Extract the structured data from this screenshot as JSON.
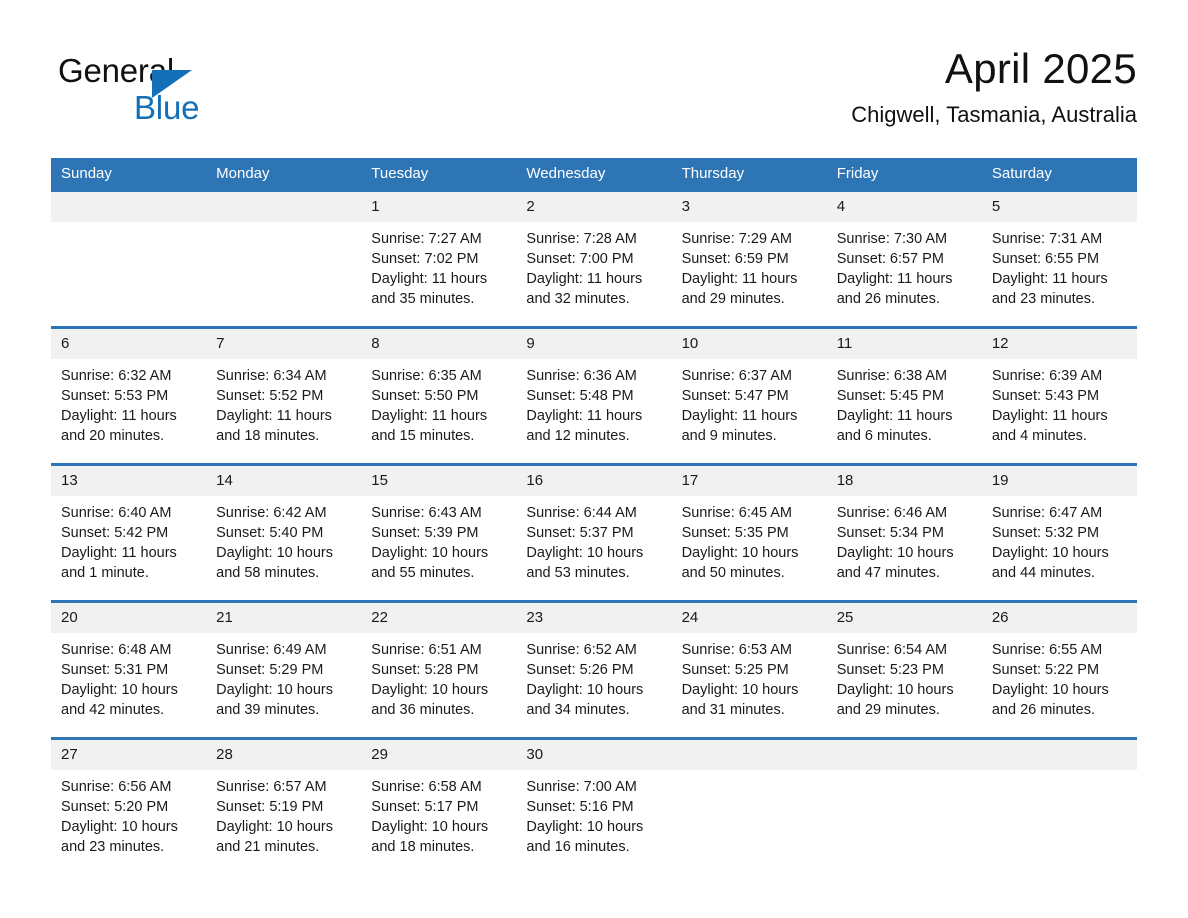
{
  "brand": {
    "name_part1": "General",
    "name_part2": "Blue",
    "accent_color": "#1470b6"
  },
  "header": {
    "month_title": "April 2025",
    "location": "Chigwell, Tasmania, Australia"
  },
  "calendar": {
    "header_background": "#2e75b6",
    "daynum_background": "#f1f1f1",
    "weekday_headers": [
      "Sunday",
      "Monday",
      "Tuesday",
      "Wednesday",
      "Thursday",
      "Friday",
      "Saturday"
    ],
    "weeks": [
      [
        {
          "day": "",
          "sunrise": "",
          "sunset": "",
          "daylight": ""
        },
        {
          "day": "",
          "sunrise": "",
          "sunset": "",
          "daylight": ""
        },
        {
          "day": "1",
          "sunrise": "Sunrise: 7:27 AM",
          "sunset": "Sunset: 7:02 PM",
          "daylight": "Daylight: 11 hours and 35 minutes."
        },
        {
          "day": "2",
          "sunrise": "Sunrise: 7:28 AM",
          "sunset": "Sunset: 7:00 PM",
          "daylight": "Daylight: 11 hours and 32 minutes."
        },
        {
          "day": "3",
          "sunrise": "Sunrise: 7:29 AM",
          "sunset": "Sunset: 6:59 PM",
          "daylight": "Daylight: 11 hours and 29 minutes."
        },
        {
          "day": "4",
          "sunrise": "Sunrise: 7:30 AM",
          "sunset": "Sunset: 6:57 PM",
          "daylight": "Daylight: 11 hours and 26 minutes."
        },
        {
          "day": "5",
          "sunrise": "Sunrise: 7:31 AM",
          "sunset": "Sunset: 6:55 PM",
          "daylight": "Daylight: 11 hours and 23 minutes."
        }
      ],
      [
        {
          "day": "6",
          "sunrise": "Sunrise: 6:32 AM",
          "sunset": "Sunset: 5:53 PM",
          "daylight": "Daylight: 11 hours and 20 minutes."
        },
        {
          "day": "7",
          "sunrise": "Sunrise: 6:34 AM",
          "sunset": "Sunset: 5:52 PM",
          "daylight": "Daylight: 11 hours and 18 minutes."
        },
        {
          "day": "8",
          "sunrise": "Sunrise: 6:35 AM",
          "sunset": "Sunset: 5:50 PM",
          "daylight": "Daylight: 11 hours and 15 minutes."
        },
        {
          "day": "9",
          "sunrise": "Sunrise: 6:36 AM",
          "sunset": "Sunset: 5:48 PM",
          "daylight": "Daylight: 11 hours and 12 minutes."
        },
        {
          "day": "10",
          "sunrise": "Sunrise: 6:37 AM",
          "sunset": "Sunset: 5:47 PM",
          "daylight": "Daylight: 11 hours and 9 minutes."
        },
        {
          "day": "11",
          "sunrise": "Sunrise: 6:38 AM",
          "sunset": "Sunset: 5:45 PM",
          "daylight": "Daylight: 11 hours and 6 minutes."
        },
        {
          "day": "12",
          "sunrise": "Sunrise: 6:39 AM",
          "sunset": "Sunset: 5:43 PM",
          "daylight": "Daylight: 11 hours and 4 minutes."
        }
      ],
      [
        {
          "day": "13",
          "sunrise": "Sunrise: 6:40 AM",
          "sunset": "Sunset: 5:42 PM",
          "daylight": "Daylight: 11 hours and 1 minute."
        },
        {
          "day": "14",
          "sunrise": "Sunrise: 6:42 AM",
          "sunset": "Sunset: 5:40 PM",
          "daylight": "Daylight: 10 hours and 58 minutes."
        },
        {
          "day": "15",
          "sunrise": "Sunrise: 6:43 AM",
          "sunset": "Sunset: 5:39 PM",
          "daylight": "Daylight: 10 hours and 55 minutes."
        },
        {
          "day": "16",
          "sunrise": "Sunrise: 6:44 AM",
          "sunset": "Sunset: 5:37 PM",
          "daylight": "Daylight: 10 hours and 53 minutes."
        },
        {
          "day": "17",
          "sunrise": "Sunrise: 6:45 AM",
          "sunset": "Sunset: 5:35 PM",
          "daylight": "Daylight: 10 hours and 50 minutes."
        },
        {
          "day": "18",
          "sunrise": "Sunrise: 6:46 AM",
          "sunset": "Sunset: 5:34 PM",
          "daylight": "Daylight: 10 hours and 47 minutes."
        },
        {
          "day": "19",
          "sunrise": "Sunrise: 6:47 AM",
          "sunset": "Sunset: 5:32 PM",
          "daylight": "Daylight: 10 hours and 44 minutes."
        }
      ],
      [
        {
          "day": "20",
          "sunrise": "Sunrise: 6:48 AM",
          "sunset": "Sunset: 5:31 PM",
          "daylight": "Daylight: 10 hours and 42 minutes."
        },
        {
          "day": "21",
          "sunrise": "Sunrise: 6:49 AM",
          "sunset": "Sunset: 5:29 PM",
          "daylight": "Daylight: 10 hours and 39 minutes."
        },
        {
          "day": "22",
          "sunrise": "Sunrise: 6:51 AM",
          "sunset": "Sunset: 5:28 PM",
          "daylight": "Daylight: 10 hours and 36 minutes."
        },
        {
          "day": "23",
          "sunrise": "Sunrise: 6:52 AM",
          "sunset": "Sunset: 5:26 PM",
          "daylight": "Daylight: 10 hours and 34 minutes."
        },
        {
          "day": "24",
          "sunrise": "Sunrise: 6:53 AM",
          "sunset": "Sunset: 5:25 PM",
          "daylight": "Daylight: 10 hours and 31 minutes."
        },
        {
          "day": "25",
          "sunrise": "Sunrise: 6:54 AM",
          "sunset": "Sunset: 5:23 PM",
          "daylight": "Daylight: 10 hours and 29 minutes."
        },
        {
          "day": "26",
          "sunrise": "Sunrise: 6:55 AM",
          "sunset": "Sunset: 5:22 PM",
          "daylight": "Daylight: 10 hours and 26 minutes."
        }
      ],
      [
        {
          "day": "27",
          "sunrise": "Sunrise: 6:56 AM",
          "sunset": "Sunset: 5:20 PM",
          "daylight": "Daylight: 10 hours and 23 minutes."
        },
        {
          "day": "28",
          "sunrise": "Sunrise: 6:57 AM",
          "sunset": "Sunset: 5:19 PM",
          "daylight": "Daylight: 10 hours and 21 minutes."
        },
        {
          "day": "29",
          "sunrise": "Sunrise: 6:58 AM",
          "sunset": "Sunset: 5:17 PM",
          "daylight": "Daylight: 10 hours and 18 minutes."
        },
        {
          "day": "30",
          "sunrise": "Sunrise: 7:00 AM",
          "sunset": "Sunset: 5:16 PM",
          "daylight": "Daylight: 10 hours and 16 minutes."
        },
        {
          "day": "",
          "sunrise": "",
          "sunset": "",
          "daylight": ""
        },
        {
          "day": "",
          "sunrise": "",
          "sunset": "",
          "daylight": ""
        },
        {
          "day": "",
          "sunrise": "",
          "sunset": "",
          "daylight": ""
        }
      ]
    ]
  }
}
